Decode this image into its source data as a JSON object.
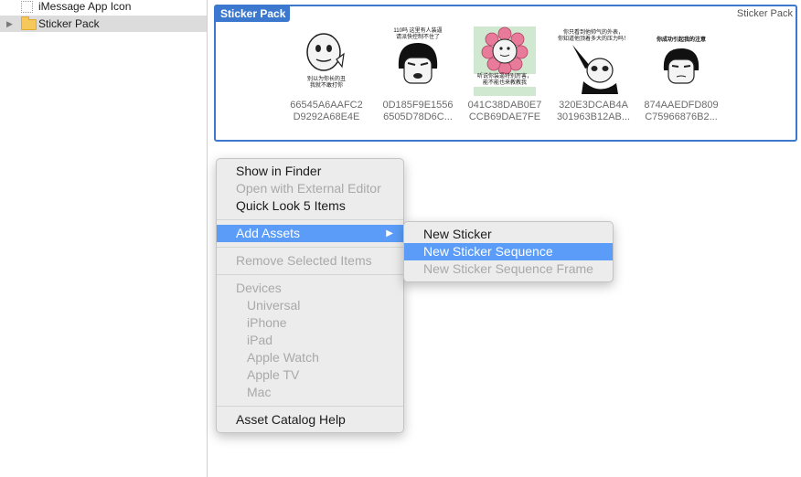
{
  "sidebar": {
    "items": [
      {
        "label": "iMessage App Icon",
        "icon": "imessage-app-icon-placeholder",
        "selected": false
      },
      {
        "label": "Sticker Pack",
        "icon": "folder-icon",
        "selected": true,
        "disclosure": "▶"
      }
    ]
  },
  "pack": {
    "title": "Sticker Pack",
    "type_label": "Sticker Pack",
    "stickers": [
      {
        "caption": "别以为你长的丑\n我就不敢打你",
        "id_line1": "66545A6AAFC2",
        "id_line2": "D9292A68E4E"
      },
      {
        "caption": "110吗 这里有人装逼\n请派快控制不住了",
        "id_line1": "0D185F9E1556",
        "id_line2": "6505D78D6C..."
      },
      {
        "caption": "听说你装逼特别厉害，\n能不能也来教教我",
        "id_line1": "041C38DAB0E7",
        "id_line2": "CCB69DAE7FE"
      },
      {
        "caption": "你只看到他帅气的外表，\n你知道他顶着多大的压力吗！",
        "id_line1": "320E3DCAB4A",
        "id_line2": "301963B12AB..."
      },
      {
        "caption": "你成功引起我的注意",
        "id_line1": "874AAEDFD809",
        "id_line2": "C75966876B2..."
      }
    ]
  },
  "context_menu": {
    "groups": [
      [
        {
          "label": "Show in Finder",
          "enabled": true
        },
        {
          "label": "Open with External Editor",
          "enabled": false
        },
        {
          "label": "Quick Look 5 Items",
          "enabled": true
        }
      ],
      [
        {
          "label": "Add Assets",
          "enabled": true,
          "highlighted": true,
          "submenu": true
        }
      ],
      [
        {
          "label": "Remove Selected Items",
          "enabled": false
        }
      ],
      [
        {
          "label": "Devices",
          "enabled": false
        },
        {
          "label": "Universal",
          "enabled": false,
          "indent": true
        },
        {
          "label": "iPhone",
          "enabled": false,
          "indent": true
        },
        {
          "label": "iPad",
          "enabled": false,
          "indent": true
        },
        {
          "label": "Apple Watch",
          "enabled": false,
          "indent": true
        },
        {
          "label": "Apple TV",
          "enabled": false,
          "indent": true
        },
        {
          "label": "Mac",
          "enabled": false,
          "indent": true
        }
      ],
      [
        {
          "label": "Asset Catalog Help",
          "enabled": true
        }
      ]
    ],
    "submenu_arrow": "▶"
  },
  "submenu": {
    "items": [
      {
        "label": "New Sticker",
        "enabled": true
      },
      {
        "label": "New Sticker Sequence",
        "enabled": true,
        "highlighted": true
      },
      {
        "label": "New Sticker Sequence Frame",
        "enabled": false
      }
    ]
  },
  "colors": {
    "accent": "#3d78cf",
    "highlight": "#5a9cf8",
    "disabled_text": "#a9a9a9"
  }
}
